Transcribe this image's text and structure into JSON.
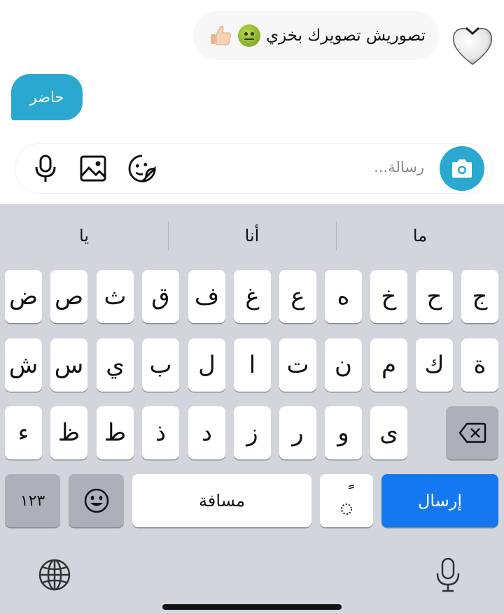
{
  "chat": {
    "incoming_text": "تصوريش تصويرك بخزي",
    "outgoing_text": "حاضر",
    "incoming_emojis": [
      "nauseated-face-emoji",
      "thumbs-up-emoji"
    ]
  },
  "composer": {
    "placeholder": "رسالة...",
    "icons": [
      "camera-icon",
      "sticker-icon",
      "image-icon",
      "microphone-icon"
    ]
  },
  "keyboard": {
    "suggestions": [
      "يا",
      "أنا",
      "ما"
    ],
    "row1": [
      "ض",
      "ص",
      "ث",
      "ق",
      "ف",
      "غ",
      "ع",
      "ه",
      "خ",
      "ح",
      "ج"
    ],
    "row2": [
      "ش",
      "س",
      "ي",
      "ب",
      "ل",
      "ا",
      "ت",
      "ن",
      "م",
      "ك",
      "ة"
    ],
    "row3": [
      "ء",
      "ظ",
      "ط",
      "ذ",
      "د",
      "ز",
      "ر",
      "و",
      "ى"
    ],
    "numbers_label": "١٢٣",
    "space_label": "مسافة",
    "tanween_label": "ً",
    "send_label": "إرسال",
    "colors": {
      "send": "#1478f0",
      "accent": "#2ba8cf",
      "keyboard_bg": "#d2d5db"
    }
  }
}
